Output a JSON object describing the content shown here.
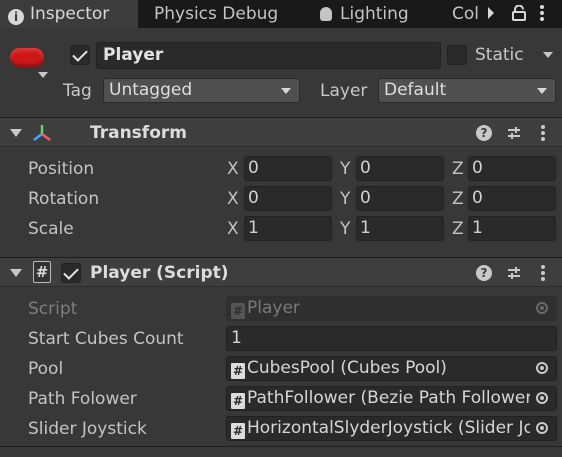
{
  "tabs": [
    {
      "label": "Inspector",
      "icon": "info-icon"
    },
    {
      "label": "Physics Debug"
    },
    {
      "label": "Lighting",
      "icon": "lightbulb-icon"
    },
    {
      "label": "Col"
    }
  ],
  "header": {
    "object_icon": "capsule-icon",
    "name": "Player",
    "static_label": "Static",
    "tag_label": "Tag",
    "tag_value": "Untagged",
    "layer_label": "Layer",
    "layer_value": "Default"
  },
  "transform": {
    "title": "Transform",
    "rows": [
      {
        "label": "Position",
        "x": "0",
        "y": "0",
        "z": "0"
      },
      {
        "label": "Rotation",
        "x": "0",
        "y": "0",
        "z": "0"
      },
      {
        "label": "Scale",
        "x": "1",
        "y": "1",
        "z": "1"
      }
    ],
    "axes": [
      "X",
      "Y",
      "Z"
    ]
  },
  "script_component": {
    "title": "Player (Script)",
    "script_label": "Script",
    "script_value": "Player",
    "fields": [
      {
        "label": "Start Cubes Count",
        "value": "1"
      },
      {
        "label": "Pool",
        "value": "CubesPool (Cubes Pool)"
      },
      {
        "label": "Path Folower",
        "value": "PathFollower (Bezie Path Follower)"
      },
      {
        "label": "Slider Joystick",
        "value": "HorizontalSlyderJoystick (Slider Joystick)"
      }
    ]
  },
  "colors": {
    "background": "#383838",
    "tab_bar": "#191919",
    "field": "#2a2a2a",
    "capsule_red": "#cc1818"
  }
}
